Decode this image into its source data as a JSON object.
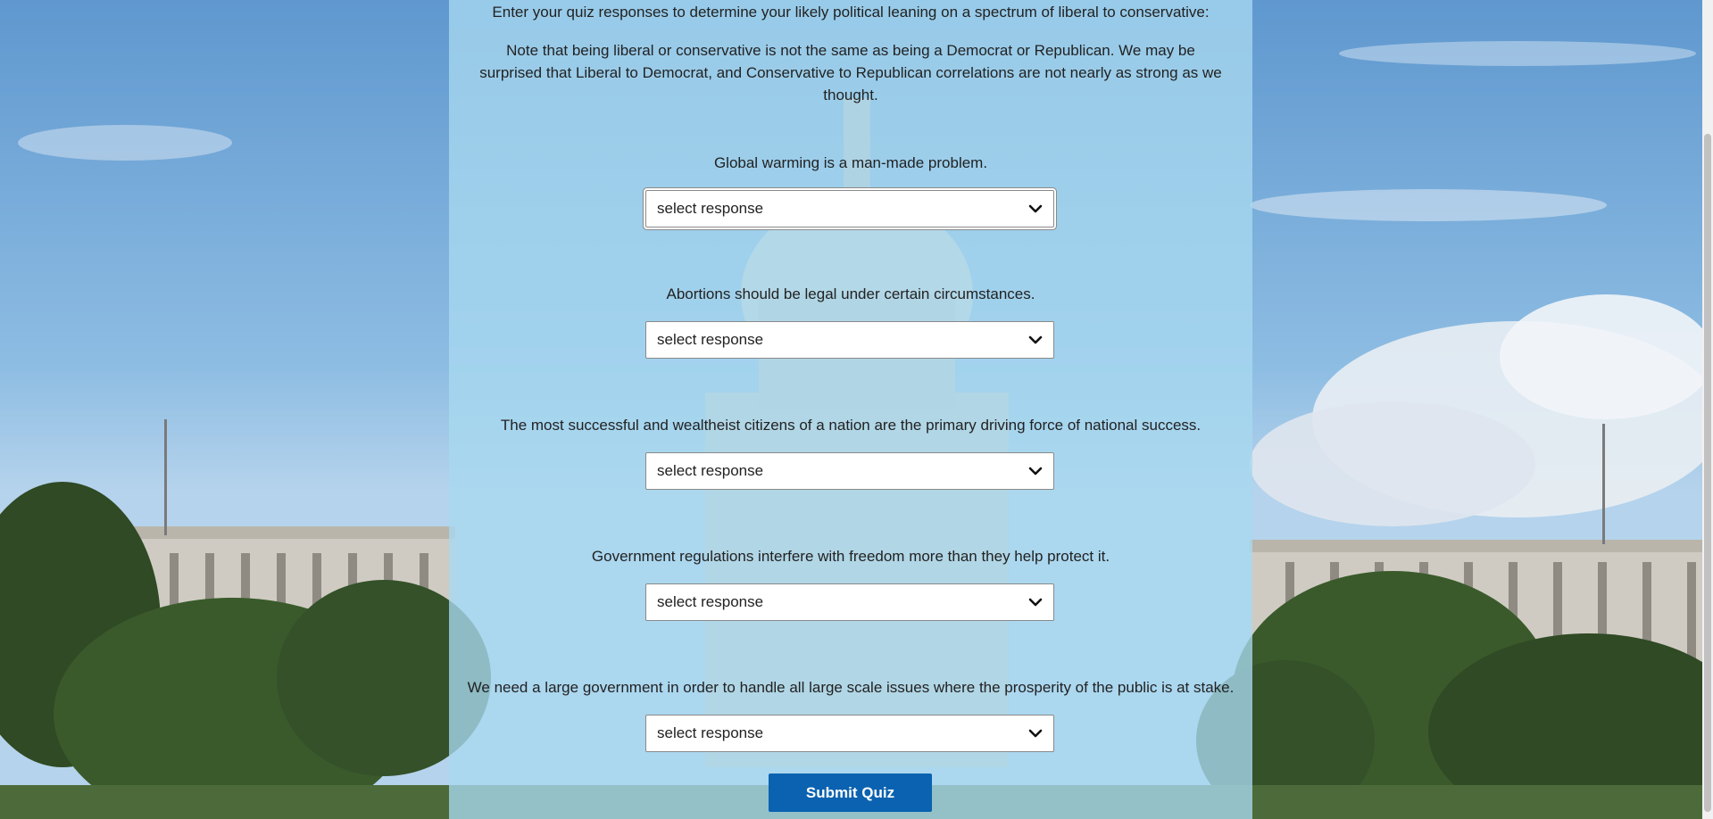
{
  "intro": "Enter your quiz responses to determine your likely political leaning on a spectrum of liberal to conservative:",
  "note": "Note that being liberal or conservative is not the same as being a Democrat or Republican. We may be surprised that Liberal to Democrat, and Conservative to Republican correlations are not nearly as strong as we thought.",
  "questions": [
    {
      "text": "Global warming is a man-made problem.",
      "value": "select response"
    },
    {
      "text": "Abortions should be legal under certain circumstances.",
      "value": "select response"
    },
    {
      "text": "The most successful and wealtheist citizens of a nation are the primary driving force of national success.",
      "value": "select response"
    },
    {
      "text": "Government regulations interfere with freedom more than they help protect it.",
      "value": "select response"
    },
    {
      "text": "We need a large government in order to handle all large scale issues where the prosperity of the public is at stake.",
      "value": "select response"
    }
  ],
  "submit_label": "Submit Quiz",
  "icons": {
    "select": "chevron-down-icon"
  },
  "colors": {
    "panel": "#a8d8f0",
    "button": "#0a62b0"
  }
}
